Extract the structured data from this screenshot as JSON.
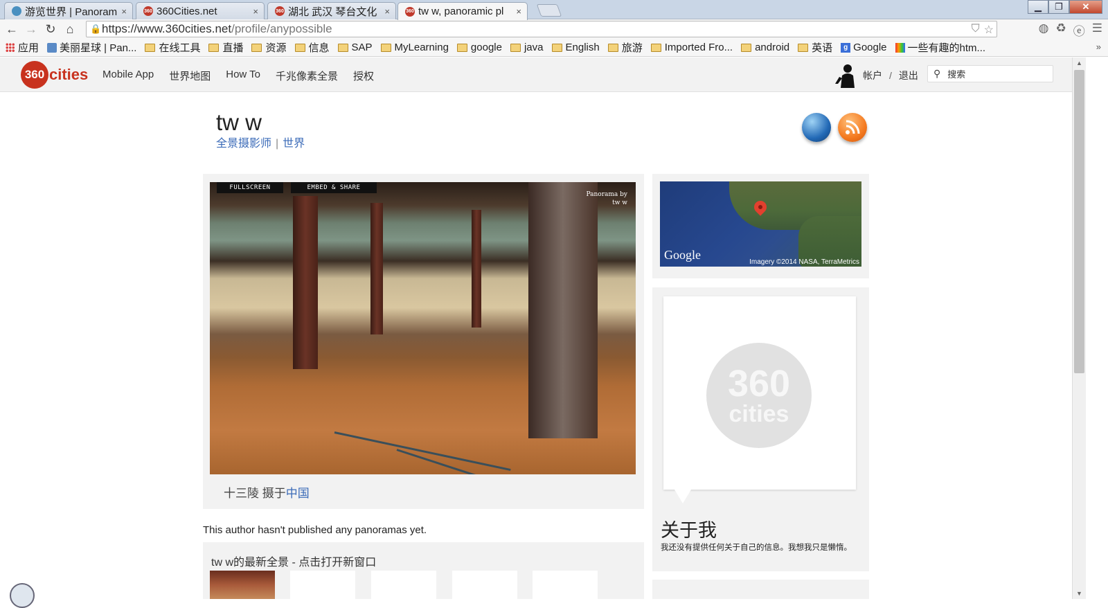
{
  "browser": {
    "tabs": [
      {
        "label": "游览世界 | Panoram",
        "close": "×",
        "icon": "person-icon"
      },
      {
        "label": "360Cities.net",
        "close": "×",
        "icon": "360-favicon"
      },
      {
        "label": "湖北 武汉 琴台文化",
        "close": "×",
        "icon": "360-favicon"
      },
      {
        "label": "tw w, panoramic pl",
        "close": "×",
        "icon": "360-favicon"
      }
    ],
    "window_buttons": {
      "minimize": "▁",
      "restore": "❐",
      "close": "✕"
    },
    "url_host": "https://www.360cities.net",
    "url_path": "/profile/anypossible",
    "bookmarks": [
      {
        "label": "应用",
        "icon": "apps-icon"
      },
      {
        "label": "美丽星球 | Pan...",
        "icon": "person-icon"
      },
      {
        "label": "在线工具",
        "icon": "folder-icon"
      },
      {
        "label": "直播",
        "icon": "folder-icon"
      },
      {
        "label": "资源",
        "icon": "folder-icon"
      },
      {
        "label": "信息",
        "icon": "folder-icon"
      },
      {
        "label": "SAP",
        "icon": "folder-icon"
      },
      {
        "label": "MyLearning",
        "icon": "folder-icon"
      },
      {
        "label": "google",
        "icon": "folder-icon"
      },
      {
        "label": "java",
        "icon": "folder-icon"
      },
      {
        "label": "English",
        "icon": "folder-icon"
      },
      {
        "label": "旅游",
        "icon": "folder-icon"
      },
      {
        "label": "Imported Fro...",
        "icon": "folder-icon"
      },
      {
        "label": "android",
        "icon": "folder-icon"
      },
      {
        "label": "英语",
        "icon": "folder-icon"
      },
      {
        "label": "Google",
        "icon": "google-icon"
      },
      {
        "label": "一些有趣的htm...",
        "icon": "multicolor-icon"
      }
    ],
    "bookmarks_more": "»"
  },
  "site": {
    "logo_number": "360",
    "logo_word": "cities",
    "nav": [
      "Mobile App",
      "世界地图",
      "How To",
      "千兆像素全景",
      "授权"
    ],
    "account_label": "帐户",
    "account_sep": "/",
    "logout_label": "退出",
    "search_placeholder": "搜索"
  },
  "profile": {
    "name": "tw w",
    "role_link": "全景摄影师",
    "sep": "|",
    "world_link": "世界",
    "pano": {
      "fullscreen_label": "FULLSCREEN",
      "embed_label": "EMBED & SHARE",
      "credit_line1": "Panorama by",
      "credit_line2": "tw w",
      "caption_prefix": "十三陵 摄于",
      "caption_link": "中国"
    },
    "no_panoramas_text": "This author hasn't published any panoramas yet.",
    "latest_title": "tw w的最新全景 - 点击打开新窗口",
    "map": {
      "logo": "Google",
      "attribution": "Imagery ©2014 NASA, TerraMetrics"
    },
    "about": {
      "placeholder_number": "360",
      "placeholder_word": "cities",
      "title": "关于我",
      "text": "我还没有提供任何关于自己的信息。我想我只是懒惰。"
    }
  },
  "colors": {
    "brand_red": "#c8321e",
    "link_blue": "#3b6bb8",
    "card_bg": "#f2f2f2"
  }
}
